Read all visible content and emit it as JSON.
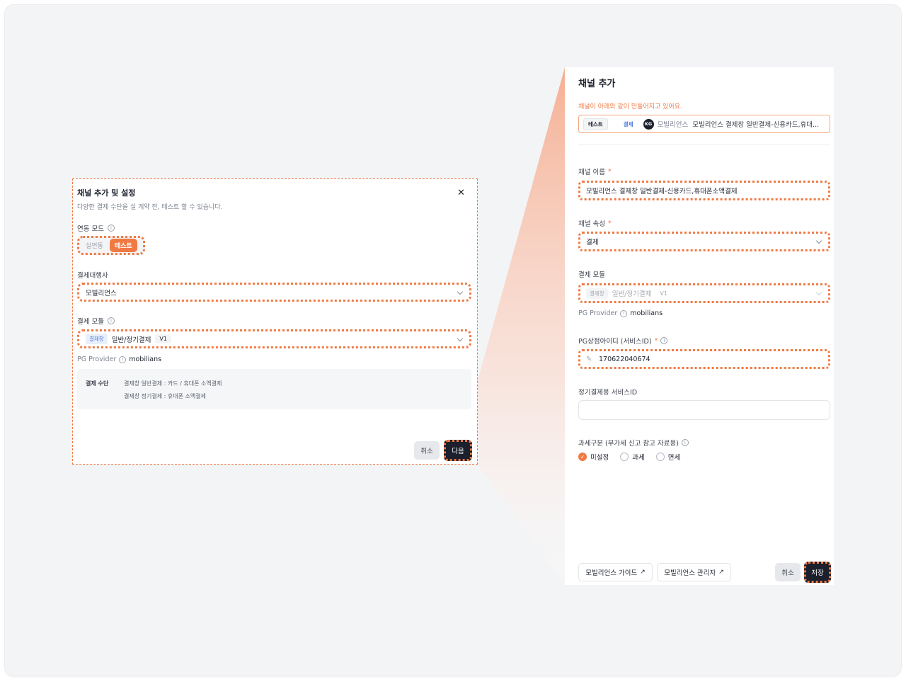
{
  "colors": {
    "accent": "#f07a44",
    "dark": "#1c1f2c",
    "link_blue": "#4a7bd6",
    "canvas": "#f3f4f6"
  },
  "left_modal": {
    "title": "채널 추가 및 설정",
    "subtitle": "다양한 결제 수단을 실 계약 전, 테스트 할 수 있습니다.",
    "close_icon": "close-icon",
    "mode_label": "연동 모드",
    "mode_options": [
      "실연동",
      "테스트"
    ],
    "mode_selected": "테스트",
    "pg_label": "결제대행사",
    "pg_value": "모빌리언스",
    "module_label": "결제 모듈",
    "module_tag": "결제창",
    "module_name": "일반/정기결제",
    "module_version": "V1",
    "pg_provider_label": "PG Provider",
    "pg_provider_value": "mobilians",
    "pay_method_label": "결제 수단",
    "pay_methods": [
      "결제창 일반결제 : 카드 / 휴대폰 소액결제",
      "결제창 정기결제 : 휴대폰 소액결제"
    ],
    "cancel_label": "취소",
    "next_label": "다음"
  },
  "right_panel": {
    "title": "채널 추가",
    "notice": "채널이 아래와 같이 만들어지고 있어요.",
    "preview": {
      "mode_chip": "테스트",
      "type_chip": "결제",
      "logo_text": "KG",
      "pg_name": "모빌리언스",
      "channel_name": "모빌리언스 결제창 일반결제-신용카드,휴대..."
    },
    "name_label": "채널 이름",
    "name_value": "모빌리언스 결제창 일반결제-신용카드,휴대폰소액결제",
    "attr_label": "채널 속성",
    "attr_value": "결제",
    "module_label": "결제 모듈",
    "module_tag": "결제창",
    "module_name": "일반/정기결제",
    "module_version": "V1",
    "pg_provider_label": "PG Provider",
    "pg_provider_value": "mobilians",
    "mid_label": "PG상점아이디 (서비스ID)",
    "mid_value": "170622040674",
    "sub_mid_label": "정기결제용 서비스ID",
    "sub_mid_value": "",
    "tax_label": "과세구분 (부가세 신고 참고 자료용)",
    "tax_options": [
      "미설정",
      "과세",
      "면세"
    ],
    "tax_selected": "미설정",
    "guide_label": "모빌리언스 가이드",
    "admin_label": "모빌리언스 관리자",
    "cancel_label": "취소",
    "save_label": "저장",
    "required_mark": "*",
    "info_icon": "info-icon",
    "external_icon": "external-link-icon"
  }
}
